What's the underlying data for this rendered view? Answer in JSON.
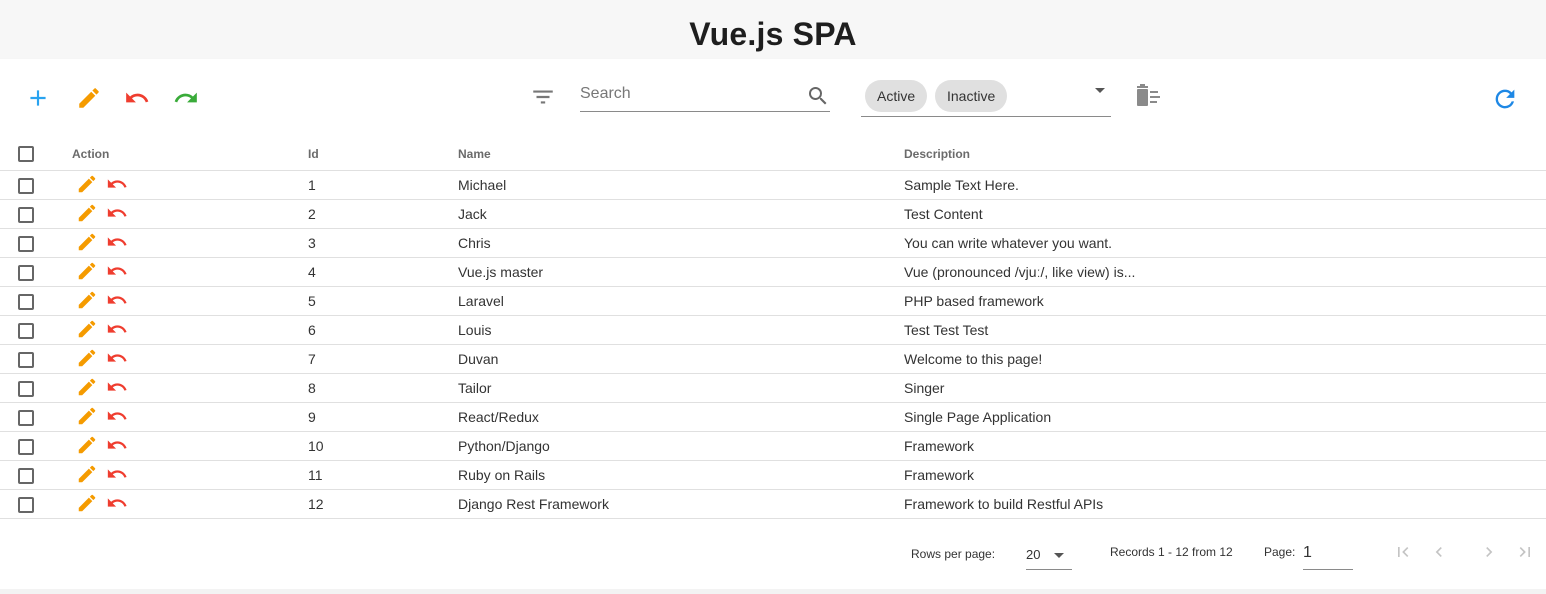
{
  "header": {
    "title": "Vue.js SPA"
  },
  "toolbar": {
    "search_placeholder": "Search",
    "status_chips": [
      "Active",
      "Inactive"
    ]
  },
  "colors": {
    "add": "#29a3f0",
    "edit": "#f59b00",
    "undo": "#ef3d2f",
    "redo": "#3aab3a",
    "refresh": "#1e88e5"
  },
  "table": {
    "headers": {
      "action": "Action",
      "id": "Id",
      "name": "Name",
      "description": "Description"
    },
    "rows": [
      {
        "id": "1",
        "name": "Michael",
        "description": "Sample Text Here."
      },
      {
        "id": "2",
        "name": "Jack",
        "description": "Test Content"
      },
      {
        "id": "3",
        "name": "Chris",
        "description": "You can write whatever you want."
      },
      {
        "id": "4",
        "name": "Vue.js master",
        "description": "Vue (pronounced /vjuː/, like view) is..."
      },
      {
        "id": "5",
        "name": "Laravel",
        "description": "PHP based framework"
      },
      {
        "id": "6",
        "name": "Louis",
        "description": "Test Test Test"
      },
      {
        "id": "7",
        "name": "Duvan",
        "description": "Welcome to this page!"
      },
      {
        "id": "8",
        "name": "Tailor",
        "description": "Singer"
      },
      {
        "id": "9",
        "name": "React/Redux",
        "description": "Single Page Application"
      },
      {
        "id": "10",
        "name": "Python/Django",
        "description": "Framework"
      },
      {
        "id": "11",
        "name": "Ruby on Rails",
        "description": "Framework"
      },
      {
        "id": "12",
        "name": "Django Rest Framework",
        "description": "Framework to build Restful APIs"
      }
    ]
  },
  "footer": {
    "rows_per_page_label": "Rows per page:",
    "rows_per_page_value": "20",
    "records_text": "Records 1 - 12 from 12",
    "page_label": "Page:",
    "page_value": "1"
  }
}
